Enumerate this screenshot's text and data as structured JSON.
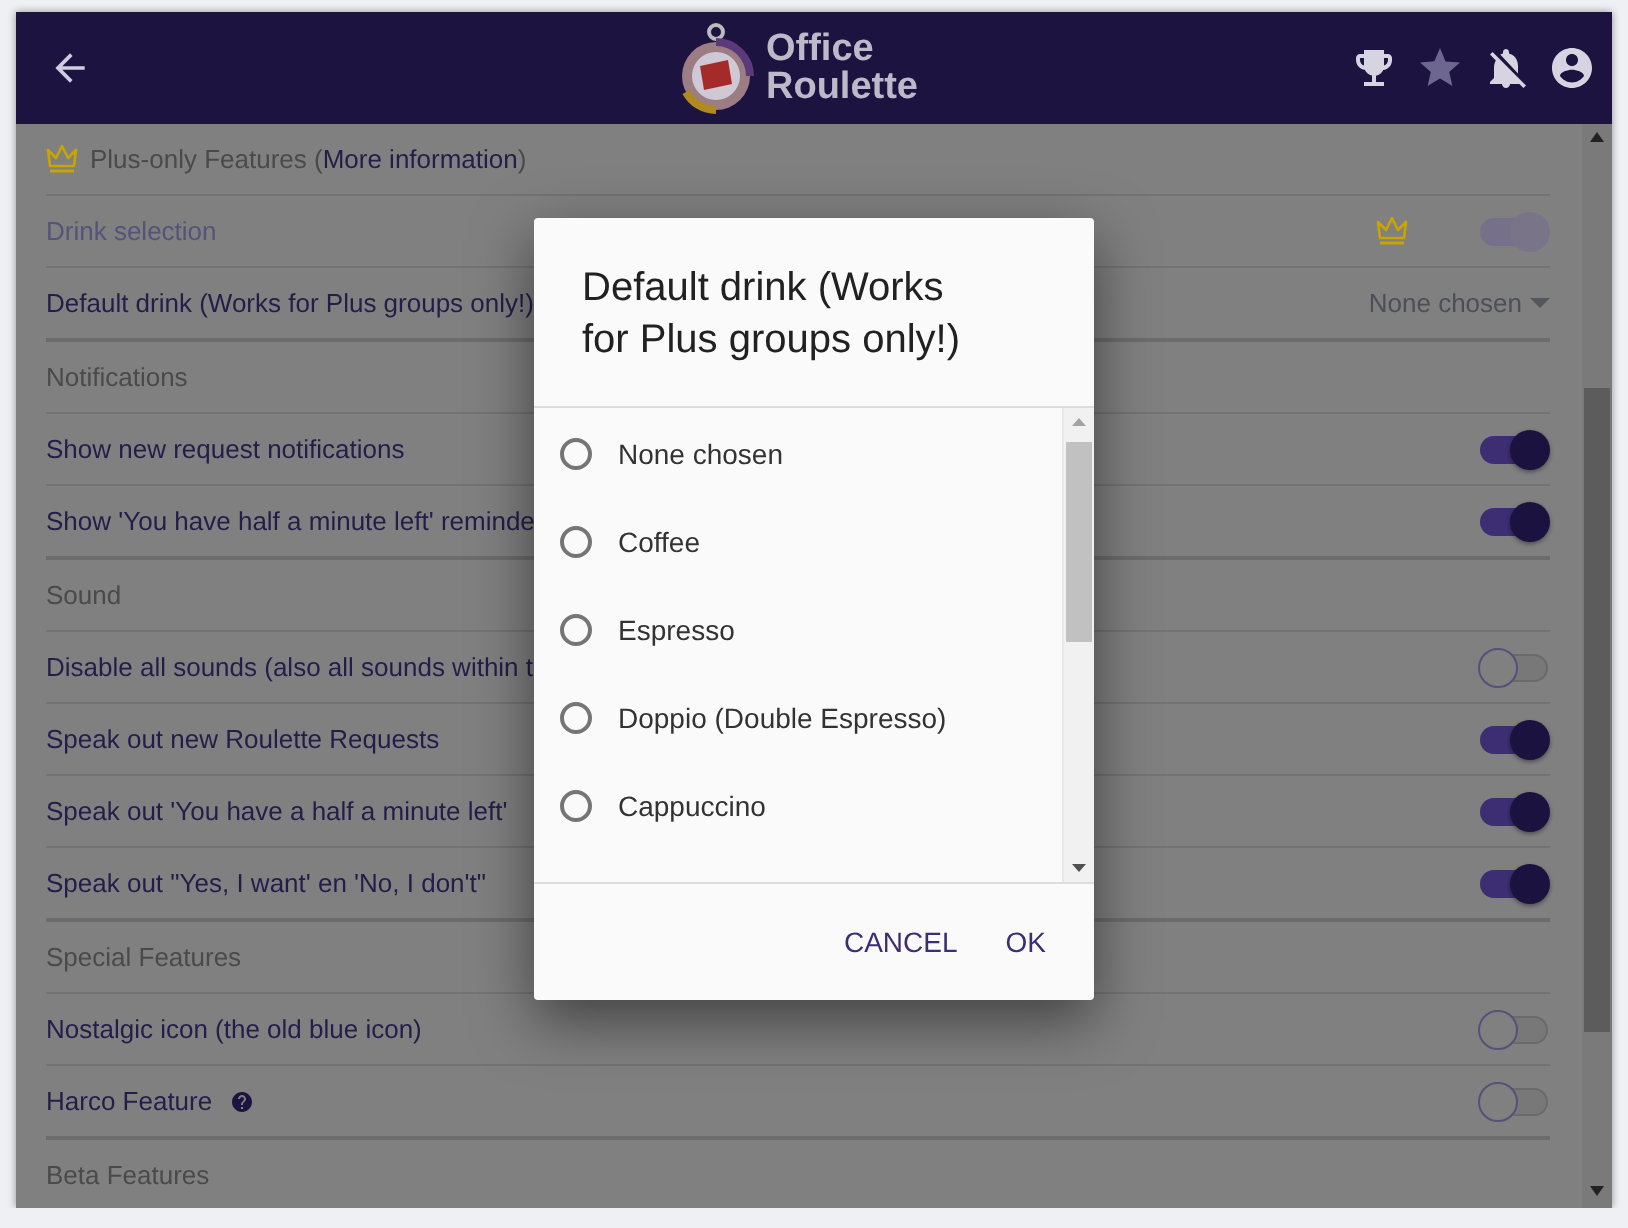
{
  "header": {
    "logo_line_1": "Office",
    "logo_line_2": "Roulette"
  },
  "sections": [
    {
      "kind": "plus",
      "prefix": "Plus-only Features (",
      "link": "More information",
      "suffix": ")",
      "rows": [
        {
          "kind": "toggle",
          "label": "Drink selection",
          "on": true,
          "disabled": true,
          "plus": true
        },
        {
          "kind": "select",
          "label": "Default drink (Works for Plus groups only!)",
          "value": "None chosen"
        }
      ]
    },
    {
      "kind": "plain",
      "title": "Notifications",
      "rows": [
        {
          "kind": "toggle",
          "label": "Show new request notifications",
          "on": true,
          "disabled": false,
          "plus": false
        },
        {
          "kind": "toggle",
          "label": "Show 'You have half a minute left' reminde",
          "on": true,
          "disabled": false,
          "plus": false
        }
      ]
    },
    {
      "kind": "plain",
      "title": "Sound",
      "rows": [
        {
          "kind": "toggle",
          "label": "Disable all sounds (also all sounds within t",
          "on": false,
          "disabled": false,
          "plus": false
        },
        {
          "kind": "toggle",
          "label": "Speak out new Roulette Requests",
          "on": true,
          "disabled": false,
          "plus": false
        },
        {
          "kind": "toggle",
          "label": "Speak out 'You have a half a minute left'",
          "on": true,
          "disabled": false,
          "plus": false
        },
        {
          "kind": "toggle",
          "label": "Speak out \"Yes, I want' en 'No, I don't\"",
          "on": true,
          "disabled": false,
          "plus": false
        }
      ]
    },
    {
      "kind": "plain",
      "title": "Special Features",
      "rows": [
        {
          "kind": "toggle",
          "label": "Nostalgic icon (the old blue icon)",
          "on": false,
          "disabled": false,
          "plus": false
        },
        {
          "kind": "help",
          "label": "Harco Feature",
          "on": false,
          "disabled": false,
          "plus": false
        }
      ]
    },
    {
      "kind": "plain",
      "title": "Beta Features"
    }
  ],
  "dialog": {
    "title": "Default drink (Works for Plus groups only!)",
    "options": [
      {
        "label": "None chosen",
        "selected": false
      },
      {
        "label": "Coffee",
        "selected": false
      },
      {
        "label": "Espresso",
        "selected": false
      },
      {
        "label": "Doppio (Double Espresso)",
        "selected": false
      },
      {
        "label": "Cappuccino",
        "selected": false
      }
    ],
    "buttons": [
      "CANCEL",
      "OK"
    ]
  }
}
